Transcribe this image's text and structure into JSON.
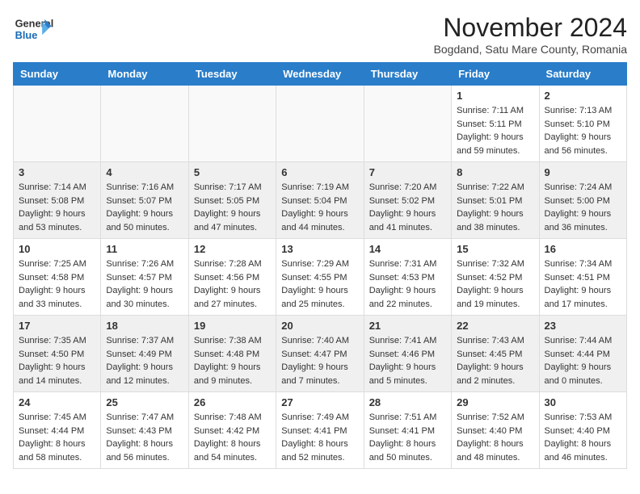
{
  "header": {
    "logo_line1": "General",
    "logo_line2": "Blue",
    "month": "November 2024",
    "location": "Bogdand, Satu Mare County, Romania"
  },
  "weekdays": [
    "Sunday",
    "Monday",
    "Tuesday",
    "Wednesday",
    "Thursday",
    "Friday",
    "Saturday"
  ],
  "weeks": [
    [
      {
        "day": "",
        "info": ""
      },
      {
        "day": "",
        "info": ""
      },
      {
        "day": "",
        "info": ""
      },
      {
        "day": "",
        "info": ""
      },
      {
        "day": "",
        "info": ""
      },
      {
        "day": "1",
        "info": "Sunrise: 7:11 AM\nSunset: 5:11 PM\nDaylight: 9 hours and 59 minutes."
      },
      {
        "day": "2",
        "info": "Sunrise: 7:13 AM\nSunset: 5:10 PM\nDaylight: 9 hours and 56 minutes."
      }
    ],
    [
      {
        "day": "3",
        "info": "Sunrise: 7:14 AM\nSunset: 5:08 PM\nDaylight: 9 hours and 53 minutes."
      },
      {
        "day": "4",
        "info": "Sunrise: 7:16 AM\nSunset: 5:07 PM\nDaylight: 9 hours and 50 minutes."
      },
      {
        "day": "5",
        "info": "Sunrise: 7:17 AM\nSunset: 5:05 PM\nDaylight: 9 hours and 47 minutes."
      },
      {
        "day": "6",
        "info": "Sunrise: 7:19 AM\nSunset: 5:04 PM\nDaylight: 9 hours and 44 minutes."
      },
      {
        "day": "7",
        "info": "Sunrise: 7:20 AM\nSunset: 5:02 PM\nDaylight: 9 hours and 41 minutes."
      },
      {
        "day": "8",
        "info": "Sunrise: 7:22 AM\nSunset: 5:01 PM\nDaylight: 9 hours and 38 minutes."
      },
      {
        "day": "9",
        "info": "Sunrise: 7:24 AM\nSunset: 5:00 PM\nDaylight: 9 hours and 36 minutes."
      }
    ],
    [
      {
        "day": "10",
        "info": "Sunrise: 7:25 AM\nSunset: 4:58 PM\nDaylight: 9 hours and 33 minutes."
      },
      {
        "day": "11",
        "info": "Sunrise: 7:26 AM\nSunset: 4:57 PM\nDaylight: 9 hours and 30 minutes."
      },
      {
        "day": "12",
        "info": "Sunrise: 7:28 AM\nSunset: 4:56 PM\nDaylight: 9 hours and 27 minutes."
      },
      {
        "day": "13",
        "info": "Sunrise: 7:29 AM\nSunset: 4:55 PM\nDaylight: 9 hours and 25 minutes."
      },
      {
        "day": "14",
        "info": "Sunrise: 7:31 AM\nSunset: 4:53 PM\nDaylight: 9 hours and 22 minutes."
      },
      {
        "day": "15",
        "info": "Sunrise: 7:32 AM\nSunset: 4:52 PM\nDaylight: 9 hours and 19 minutes."
      },
      {
        "day": "16",
        "info": "Sunrise: 7:34 AM\nSunset: 4:51 PM\nDaylight: 9 hours and 17 minutes."
      }
    ],
    [
      {
        "day": "17",
        "info": "Sunrise: 7:35 AM\nSunset: 4:50 PM\nDaylight: 9 hours and 14 minutes."
      },
      {
        "day": "18",
        "info": "Sunrise: 7:37 AM\nSunset: 4:49 PM\nDaylight: 9 hours and 12 minutes."
      },
      {
        "day": "19",
        "info": "Sunrise: 7:38 AM\nSunset: 4:48 PM\nDaylight: 9 hours and 9 minutes."
      },
      {
        "day": "20",
        "info": "Sunrise: 7:40 AM\nSunset: 4:47 PM\nDaylight: 9 hours and 7 minutes."
      },
      {
        "day": "21",
        "info": "Sunrise: 7:41 AM\nSunset: 4:46 PM\nDaylight: 9 hours and 5 minutes."
      },
      {
        "day": "22",
        "info": "Sunrise: 7:43 AM\nSunset: 4:45 PM\nDaylight: 9 hours and 2 minutes."
      },
      {
        "day": "23",
        "info": "Sunrise: 7:44 AM\nSunset: 4:44 PM\nDaylight: 9 hours and 0 minutes."
      }
    ],
    [
      {
        "day": "24",
        "info": "Sunrise: 7:45 AM\nSunset: 4:44 PM\nDaylight: 8 hours and 58 minutes."
      },
      {
        "day": "25",
        "info": "Sunrise: 7:47 AM\nSunset: 4:43 PM\nDaylight: 8 hours and 56 minutes."
      },
      {
        "day": "26",
        "info": "Sunrise: 7:48 AM\nSunset: 4:42 PM\nDaylight: 8 hours and 54 minutes."
      },
      {
        "day": "27",
        "info": "Sunrise: 7:49 AM\nSunset: 4:41 PM\nDaylight: 8 hours and 52 minutes."
      },
      {
        "day": "28",
        "info": "Sunrise: 7:51 AM\nSunset: 4:41 PM\nDaylight: 8 hours and 50 minutes."
      },
      {
        "day": "29",
        "info": "Sunrise: 7:52 AM\nSunset: 4:40 PM\nDaylight: 8 hours and 48 minutes."
      },
      {
        "day": "30",
        "info": "Sunrise: 7:53 AM\nSunset: 4:40 PM\nDaylight: 8 hours and 46 minutes."
      }
    ]
  ]
}
